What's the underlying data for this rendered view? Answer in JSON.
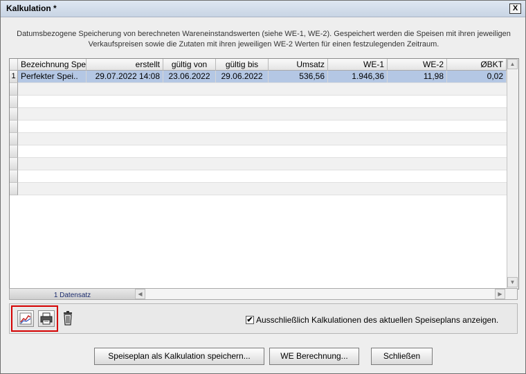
{
  "window": {
    "title": "Kalkulation *",
    "close_label": "X"
  },
  "description": {
    "line1": "Datumsbezogene Speicherung von berechneten Wareneinstandswerten (siehe WE-1, WE-2). Gespeichert werden die Speisen mit ihren jeweiligen",
    "line2": "Verkaufspreisen sowie die Zutaten mit ihren jeweiligen WE-2 Werten für einen festzulegenden Zeitraum."
  },
  "table": {
    "columns": [
      "Bezeichnung Spe",
      "erstellt",
      "gültig von",
      "gültig bis",
      "Umsatz",
      "WE-1",
      "WE-2",
      "ØBKT"
    ],
    "rows": [
      {
        "index": "1",
        "cells": [
          "Perfekter Spei..",
          "29.07.2022 14:08",
          "23.06.2022",
          "29.06.2022",
          "536,56",
          "1.946,36",
          "11,98",
          "0,02"
        ]
      }
    ],
    "empty_row_count": 9
  },
  "status": {
    "count_label": "1 Datensatz"
  },
  "toolbar": {
    "chart_icon": "chart-icon",
    "print_icon": "printer-icon",
    "delete_icon": "trash-icon",
    "checkbox_checked": true,
    "checkbox_mark": "✔",
    "checkbox_label": "Ausschließlich Kalkulationen des aktuellen Speiseplans anzeigen."
  },
  "buttons": {
    "save_plan": "Speiseplan als Kalkulation speichern...",
    "we_calc": "WE Berechnung...",
    "close": "Schließen"
  },
  "colors": {
    "selection": "#b4c7e4",
    "highlight": "#d40000",
    "status_text": "#1a2b6d"
  }
}
